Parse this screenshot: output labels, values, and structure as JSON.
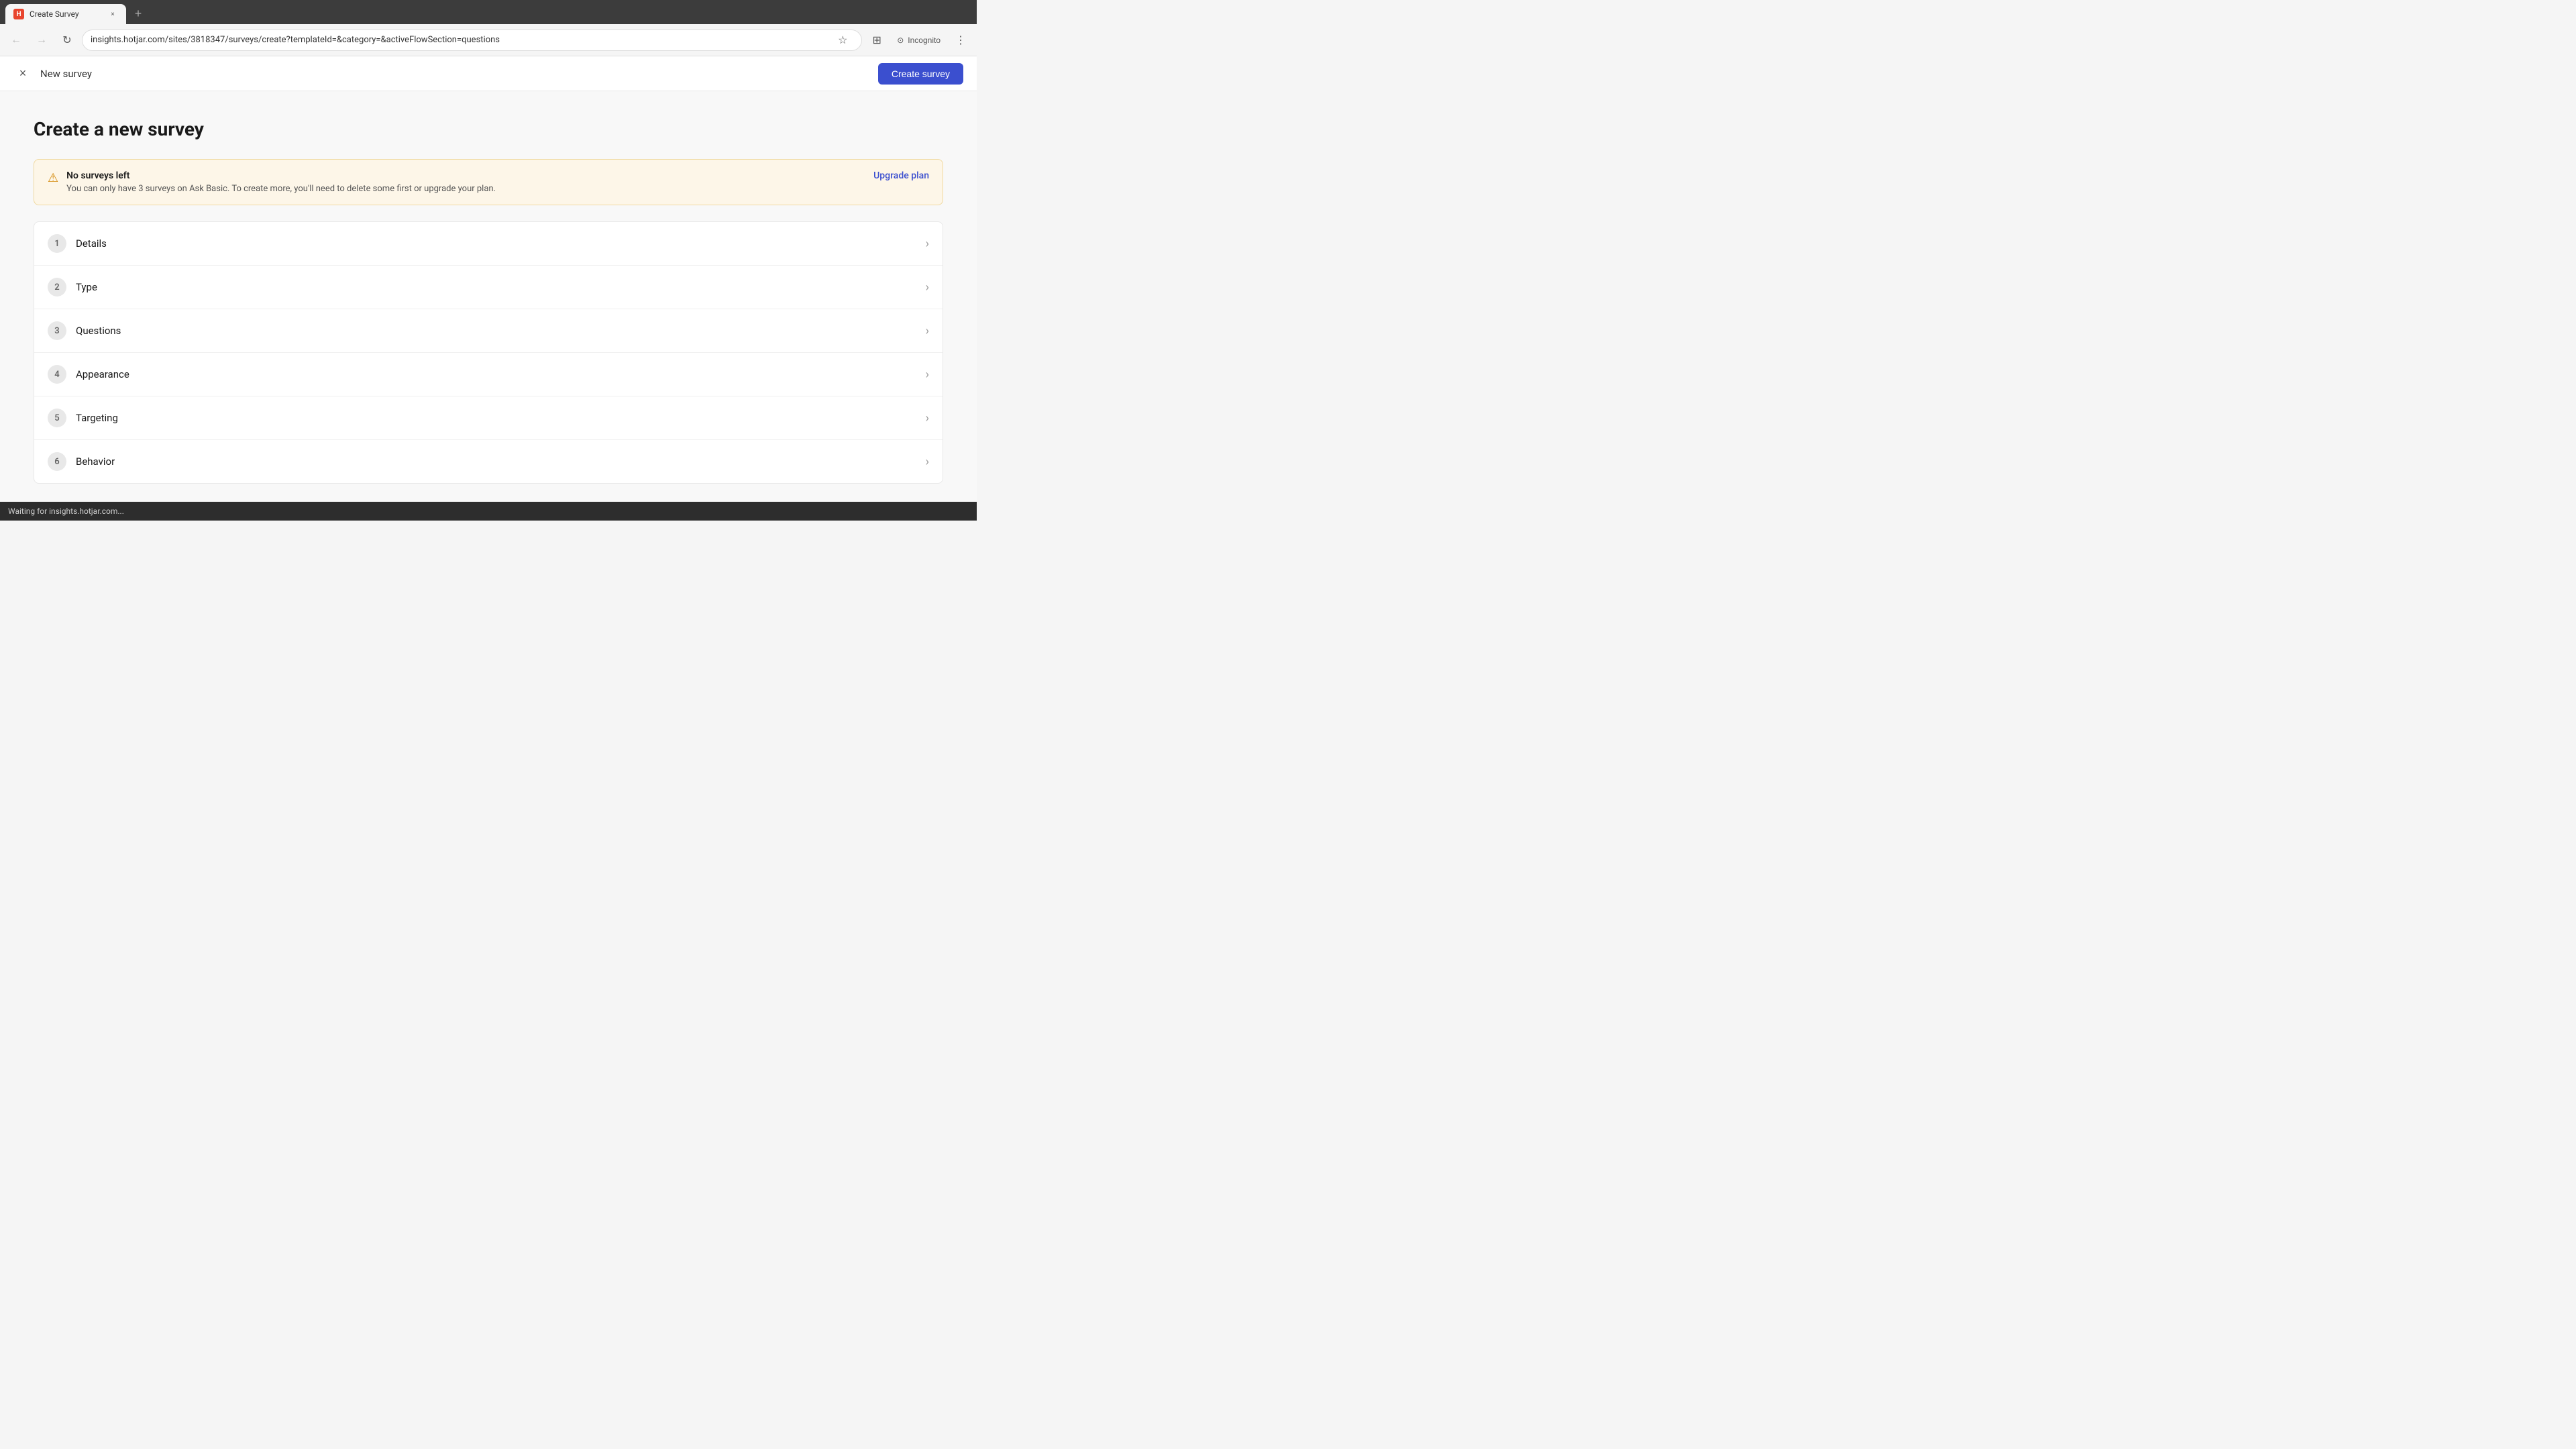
{
  "browser": {
    "tab": {
      "favicon_text": "H",
      "label": "Create Survey",
      "close_icon": "×"
    },
    "new_tab_icon": "+",
    "nav": {
      "back_icon": "←",
      "forward_icon": "→",
      "reload_icon": "↻"
    },
    "url": "insights.hotjar.com/sites/3818347/surveys/create?templateId=&category=&activeFlowSection=questions",
    "bookmark_icon": "☆",
    "extensions_icon": "⊞",
    "incognito_icon": "⊙",
    "incognito_label": "Incognito",
    "menu_icon": "⋮"
  },
  "app_header": {
    "close_icon": "×",
    "title": "New survey",
    "create_button_label": "Create survey"
  },
  "main": {
    "page_title": "Create a new survey",
    "warning": {
      "icon": "⚠",
      "title": "No surveys left",
      "text": "You can only have 3 surveys on Ask Basic. To create more, you'll need to delete some first or upgrade your plan.",
      "upgrade_label": "Upgrade plan"
    },
    "steps": [
      {
        "number": "1",
        "label": "Details"
      },
      {
        "number": "2",
        "label": "Type"
      },
      {
        "number": "3",
        "label": "Questions"
      },
      {
        "number": "4",
        "label": "Appearance"
      },
      {
        "number": "5",
        "label": "Targeting"
      },
      {
        "number": "6",
        "label": "Behavior"
      }
    ],
    "chevron_icon": "›"
  },
  "status_bar": {
    "text": "Waiting for insights.hotjar.com..."
  },
  "colors": {
    "accent": "#3b4fcf",
    "warning_bg": "#fdf6e8",
    "warning_border": "#f0d9a0",
    "warning_icon": "#d4890a"
  }
}
